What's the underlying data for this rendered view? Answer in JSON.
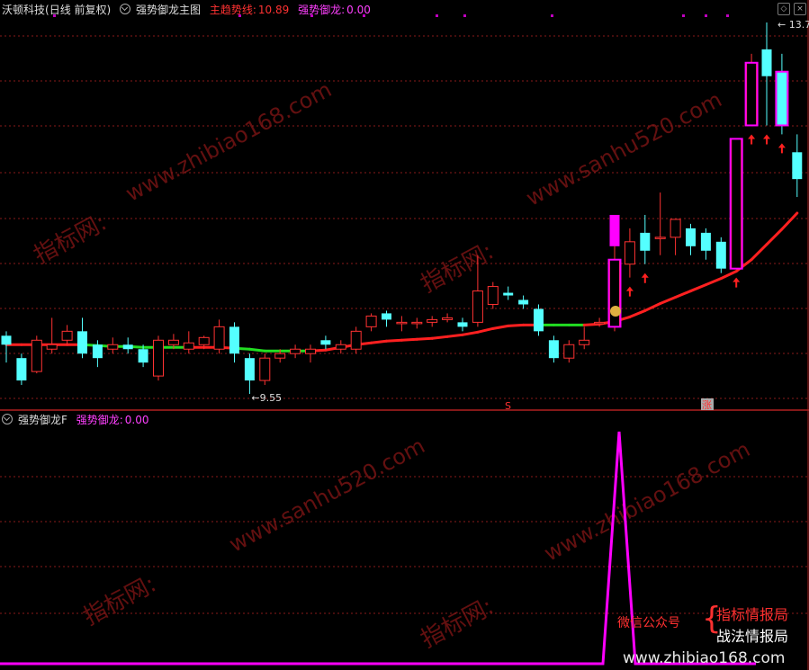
{
  "top_panel": {
    "stock": "沃顿科技",
    "period": "(日线 前复权)",
    "indicator": "强势御龙主图",
    "trend_label": "主趋势线:",
    "trend_value": "10.89",
    "signal_label": "强势御龙:",
    "signal_value": "0.00",
    "high_label": "13.70",
    "low_label": "9.55",
    "marker_s": "S",
    "marker_z": "涨"
  },
  "bottom_panel": {
    "indicator": "强势御龙F",
    "signal_label": "强势御龙:",
    "signal_value": "0.00"
  },
  "controls": {
    "close": "×",
    "pin": "◇"
  },
  "watermarks": {
    "site1": "www.zhibiao168.com",
    "site2": "www.sanhu520.com",
    "brand": "指标网:",
    "wechat": "微信公众号",
    "wechat_1": "指标情报局",
    "wechat_2": "战法情报局",
    "url": "www.zhibiao168.com"
  },
  "colors": {
    "up": "#ff3232",
    "down": "#54ffff",
    "ma_up": "#ff2020",
    "ma_flat": "#22dd22",
    "signal": "#ff00ff",
    "grid": "#8a1a1a"
  },
  "chart_data": {
    "type": "candlestick",
    "candles": [
      [
        10.1,
        10.2,
        9.9,
        10.25,
        "d"
      ],
      [
        9.95,
        9.7,
        9.65,
        10.0,
        "d"
      ],
      [
        9.8,
        10.15,
        9.78,
        10.2,
        "u"
      ],
      [
        10.05,
        10.1,
        10.0,
        10.4,
        "u"
      ],
      [
        10.15,
        10.25,
        10.1,
        10.32,
        "u"
      ],
      [
        10.25,
        10.0,
        9.95,
        10.4,
        "d"
      ],
      [
        10.1,
        9.95,
        9.85,
        10.15,
        "d"
      ],
      [
        10.05,
        10.1,
        10.0,
        10.18,
        "u"
      ],
      [
        10.1,
        10.05,
        10.0,
        10.18,
        "d"
      ],
      [
        10.05,
        9.9,
        9.85,
        10.1,
        "d"
      ],
      [
        9.75,
        10.15,
        9.7,
        10.2,
        "u"
      ],
      [
        10.1,
        10.15,
        10.05,
        10.22,
        "u"
      ],
      [
        10.05,
        10.12,
        10.0,
        10.25,
        "u"
      ],
      [
        10.1,
        10.18,
        10.05,
        10.2,
        "u"
      ],
      [
        10.05,
        10.3,
        10.0,
        10.38,
        "u"
      ],
      [
        10.3,
        10.0,
        9.9,
        10.35,
        "d"
      ],
      [
        9.95,
        9.7,
        9.55,
        10.0,
        "d"
      ],
      [
        9.7,
        9.95,
        9.65,
        10.0,
        "u"
      ],
      [
        9.95,
        10.0,
        9.9,
        10.05,
        "u"
      ],
      [
        10.0,
        10.05,
        9.95,
        10.1,
        "u"
      ],
      [
        10.0,
        10.05,
        9.9,
        10.1,
        "u"
      ],
      [
        10.15,
        10.1,
        10.05,
        10.2,
        "d"
      ],
      [
        10.05,
        10.1,
        10.0,
        10.15,
        "u"
      ],
      [
        10.05,
        10.25,
        10.0,
        10.3,
        "u"
      ],
      [
        10.3,
        10.42,
        10.25,
        10.45,
        "u"
      ],
      [
        10.45,
        10.38,
        10.3,
        10.48,
        "d"
      ],
      [
        10.35,
        10.35,
        10.25,
        10.42,
        "u"
      ],
      [
        10.35,
        10.35,
        10.28,
        10.4,
        "u"
      ],
      [
        10.35,
        10.38,
        10.3,
        10.42,
        "u"
      ],
      [
        10.38,
        10.4,
        10.35,
        10.45,
        "u"
      ],
      [
        10.35,
        10.3,
        10.25,
        10.4,
        "d"
      ],
      [
        10.35,
        10.7,
        10.3,
        11.1,
        "u"
      ],
      [
        10.55,
        10.75,
        10.5,
        10.8,
        "u"
      ],
      [
        10.68,
        10.65,
        10.6,
        10.75,
        "d"
      ],
      [
        10.6,
        10.55,
        10.5,
        10.65,
        "d"
      ],
      [
        10.5,
        10.25,
        10.2,
        10.55,
        "d"
      ],
      [
        10.15,
        9.95,
        9.9,
        10.2,
        "d"
      ],
      [
        9.95,
        10.1,
        9.9,
        10.15,
        "u"
      ],
      [
        10.1,
        10.15,
        10.05,
        10.3,
        "u"
      ],
      [
        10.35,
        10.35,
        10.3,
        10.4,
        "u"
      ],
      [
        10.3,
        11.05,
        10.25,
        11.2,
        "u"
      ],
      [
        11.0,
        11.25,
        10.85,
        11.4,
        "u"
      ],
      [
        11.15,
        11.35,
        11.0,
        11.55,
        "d"
      ],
      [
        11.3,
        11.3,
        11.1,
        11.8,
        "u"
      ],
      [
        11.3,
        11.5,
        11.1,
        11.5,
        "u"
      ],
      [
        11.4,
        11.2,
        11.1,
        11.45,
        "d"
      ],
      [
        11.15,
        11.35,
        11.05,
        11.4,
        "d"
      ],
      [
        10.95,
        11.25,
        10.9,
        11.3,
        "d"
      ],
      [
        10.95,
        12.4,
        10.95,
        12.4,
        "u"
      ],
      [
        12.55,
        13.25,
        12.55,
        13.35,
        "u"
      ],
      [
        13.4,
        13.1,
        12.55,
        13.7,
        "d"
      ],
      [
        13.15,
        12.55,
        12.45,
        13.35,
        "d"
      ],
      [
        12.25,
        11.95,
        11.75,
        12.45,
        "d"
      ]
    ],
    "trend": [
      10.1,
      10.1,
      10.1,
      10.1,
      10.1,
      10.1,
      10.09,
      10.08,
      10.08,
      10.07,
      10.07,
      10.07,
      10.07,
      10.07,
      10.07,
      10.06,
      10.05,
      10.03,
      10.03,
      10.03,
      10.03,
      10.04,
      10.07,
      10.1,
      10.12,
      10.14,
      10.15,
      10.16,
      10.17,
      10.19,
      10.21,
      10.24,
      10.28,
      10.31,
      10.32,
      10.32,
      10.32,
      10.32,
      10.32,
      10.33,
      10.36,
      10.41,
      10.48,
      10.56,
      10.63,
      10.7,
      10.77,
      10.84,
      10.92,
      11.05,
      11.22,
      11.39,
      11.57
    ],
    "trend_green_ranges": [
      [
        5,
        12
      ],
      [
        15,
        20
      ],
      [
        35,
        38
      ]
    ],
    "signal_F": {
      "peak_index": 40,
      "peak_value": 1.0,
      "baseline": 0.0
    }
  }
}
